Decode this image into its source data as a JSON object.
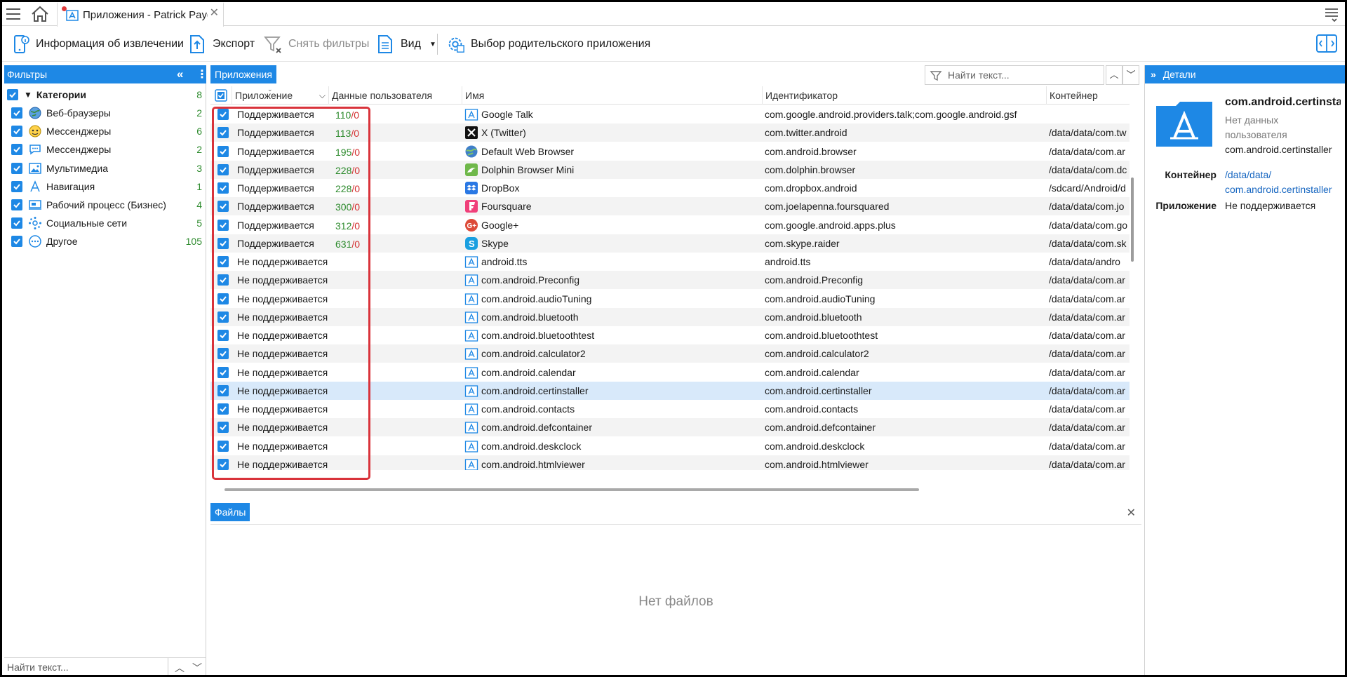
{
  "tabbar": {
    "tab_title": "Приложения - Patrick Payg..."
  },
  "toolbar": {
    "extraction_info": "Информация об извлечении",
    "export": "Экспорт",
    "clear_filters": "Снять фильтры",
    "view": "Вид",
    "parent_app": "Выбор родительского приложения"
  },
  "filters": {
    "title": "Фильтры",
    "root_label": "Категории",
    "root_count": "8",
    "items": [
      {
        "label": "Веб-браузеры",
        "count": "2",
        "icon": "globe-icon"
      },
      {
        "label": "Мессенджеры",
        "count": "6",
        "icon": "messenger-icon"
      },
      {
        "label": "Мессенджеры",
        "count": "2",
        "icon": "chat-bubble-icon"
      },
      {
        "label": "Мультимедиа",
        "count": "3",
        "icon": "multimedia-icon"
      },
      {
        "label": "Навигация",
        "count": "1",
        "icon": "navigation-icon"
      },
      {
        "label": "Рабочий процесс (Бизнес)",
        "count": "4",
        "icon": "business-icon"
      },
      {
        "label": "Социальные сети",
        "count": "5",
        "icon": "social-icon"
      },
      {
        "label": "Другое",
        "count": "105",
        "icon": "other-icon"
      }
    ],
    "search_placeholder": "Найти текст..."
  },
  "apps": {
    "tab": "Приложения",
    "search_placeholder": "Найти текст...",
    "columns": {
      "app": "Приложение",
      "user_data": "Данные пользователя",
      "name": "Имя",
      "identifier": "Идентификатор",
      "container": "Контейнер"
    },
    "rows": [
      {
        "status": "Поддерживается",
        "ud": "110",
        "udz": "/0",
        "name": "Google Talk",
        "id": "com.google.android.providers.talk;com.google.android.gsf",
        "container": "",
        "icon": "app-generic-icon"
      },
      {
        "status": "Поддерживается",
        "ud": "113",
        "udz": "/0",
        "name": "X (Twitter)",
        "id": "com.twitter.android",
        "container": "/data/data/com.tw",
        "icon": "x-twitter-icon"
      },
      {
        "status": "Поддерживается",
        "ud": "195",
        "udz": "/0",
        "name": "Default Web Browser",
        "id": "com.android.browser",
        "container": "/data/data/com.ar",
        "icon": "browser-globe-icon"
      },
      {
        "status": "Поддерживается",
        "ud": "228",
        "udz": "/0",
        "name": "Dolphin Browser Mini",
        "id": "com.dolphin.browser",
        "container": "/data/data/com.dc",
        "icon": "dolphin-icon"
      },
      {
        "status": "Поддерживается",
        "ud": "228",
        "udz": "/0",
        "name": "DropBox",
        "id": "com.dropbox.android",
        "container": "/sdcard/Android/d",
        "icon": "dropbox-icon"
      },
      {
        "status": "Поддерживается",
        "ud": "300",
        "udz": "/0",
        "name": "Foursquare",
        "id": "com.joelapenna.foursquared",
        "container": "/data/data/com.jo",
        "icon": "foursquare-icon"
      },
      {
        "status": "Поддерживается",
        "ud": "312",
        "udz": "/0",
        "name": "Google+",
        "id": "com.google.android.apps.plus",
        "container": "/data/data/com.go",
        "icon": "google-plus-icon"
      },
      {
        "status": "Поддерживается",
        "ud": "631",
        "udz": "/0",
        "name": "Skype",
        "id": "com.skype.raider",
        "container": "/data/data/com.sk",
        "icon": "skype-icon"
      },
      {
        "status": "Не поддерживается",
        "ud": "",
        "udz": "",
        "name": "android.tts",
        "id": "android.tts",
        "container": "/data/data/andro",
        "icon": "app-generic-icon"
      },
      {
        "status": "Не поддерживается",
        "ud": "",
        "udz": "",
        "name": "com.android.Preconfig",
        "id": "com.android.Preconfig",
        "container": "/data/data/com.ar",
        "icon": "app-generic-icon"
      },
      {
        "status": "Не поддерживается",
        "ud": "",
        "udz": "",
        "name": "com.android.audioTuning",
        "id": "com.android.audioTuning",
        "container": "/data/data/com.ar",
        "icon": "app-generic-icon"
      },
      {
        "status": "Не поддерживается",
        "ud": "",
        "udz": "",
        "name": "com.android.bluetooth",
        "id": "com.android.bluetooth",
        "container": "/data/data/com.ar",
        "icon": "app-generic-icon"
      },
      {
        "status": "Не поддерживается",
        "ud": "",
        "udz": "",
        "name": "com.android.bluetoothtest",
        "id": "com.android.bluetoothtest",
        "container": "/data/data/com.ar",
        "icon": "app-generic-icon"
      },
      {
        "status": "Не поддерживается",
        "ud": "",
        "udz": "",
        "name": "com.android.calculator2",
        "id": "com.android.calculator2",
        "container": "/data/data/com.ar",
        "icon": "app-generic-icon"
      },
      {
        "status": "Не поддерживается",
        "ud": "",
        "udz": "",
        "name": "com.android.calendar",
        "id": "com.android.calendar",
        "container": "/data/data/com.ar",
        "icon": "app-generic-icon"
      },
      {
        "status": "Не поддерживается",
        "ud": "",
        "udz": "",
        "name": "com.android.certinstaller",
        "id": "com.android.certinstaller",
        "container": "/data/data/com.ar",
        "icon": "app-generic-icon"
      },
      {
        "status": "Не поддерживается",
        "ud": "",
        "udz": "",
        "name": "com.android.contacts",
        "id": "com.android.contacts",
        "container": "/data/data/com.ar",
        "icon": "app-generic-icon"
      },
      {
        "status": "Не поддерживается",
        "ud": "",
        "udz": "",
        "name": "com.android.defcontainer",
        "id": "com.android.defcontainer",
        "container": "/data/data/com.ar",
        "icon": "app-generic-icon"
      },
      {
        "status": "Не поддерживается",
        "ud": "",
        "udz": "",
        "name": "com.android.deskclock",
        "id": "com.android.deskclock",
        "container": "/data/data/com.ar",
        "icon": "app-generic-icon"
      },
      {
        "status": "Не поддерживается",
        "ud": "",
        "udz": "",
        "name": "com.android.htmlviewer",
        "id": "com.android.htmlviewer",
        "container": "/data/data/com.ar",
        "icon": "app-generic-icon"
      }
    ]
  },
  "files": {
    "tab": "Файлы",
    "empty": "Нет файлов"
  },
  "details": {
    "title": "Детали",
    "app_name": "com.android.certinstaller",
    "no_data_1": "Нет данных",
    "no_data_2": "пользователя",
    "package": "com.android.certinstaller",
    "container_label": "Контейнер",
    "container_value_1": "/data/data/",
    "container_value_2": "com.android.certinstaller",
    "app_label": "Приложение",
    "app_value": "Не поддерживается"
  },
  "colors": {
    "accent": "#1e88e5",
    "count_green": "#2e8b2e",
    "zero_red": "#d32f2f",
    "highlight_box": "#d9333b",
    "selected_row": "#d8e9fa"
  }
}
